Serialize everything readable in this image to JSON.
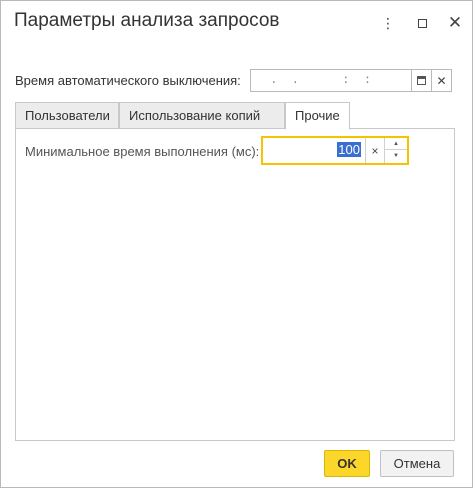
{
  "window": {
    "title": "Параметры анализа запросов",
    "more_icon": "more-vert-icon",
    "maximize_icon": "maximize-icon",
    "close_icon": "close-icon",
    "more_glyph": "⋮",
    "close_glyph": "✕"
  },
  "auto_off": {
    "label": "Время автоматического выключения:",
    "value": " .  .      :  :",
    "calendar_icon": "calendar-icon",
    "clear_glyph": "✕"
  },
  "tabs": [
    {
      "label": "Пользователи",
      "active": false
    },
    {
      "label": "Использование копий",
      "active": false
    },
    {
      "label": "Прочие",
      "active": true
    }
  ],
  "other_tab": {
    "min_time_label": "Минимальное время выполнения (мс):",
    "min_time_value": "100",
    "clear_glyph": "×",
    "spin_up_glyph": "▲",
    "spin_down_glyph": "▼"
  },
  "buttons": {
    "ok_label": "OK",
    "cancel_label": "Отмена"
  },
  "colors": {
    "accent_yellow": "#fcd72a",
    "focus_border": "#f5c400",
    "selection": "#3a6fd0"
  }
}
